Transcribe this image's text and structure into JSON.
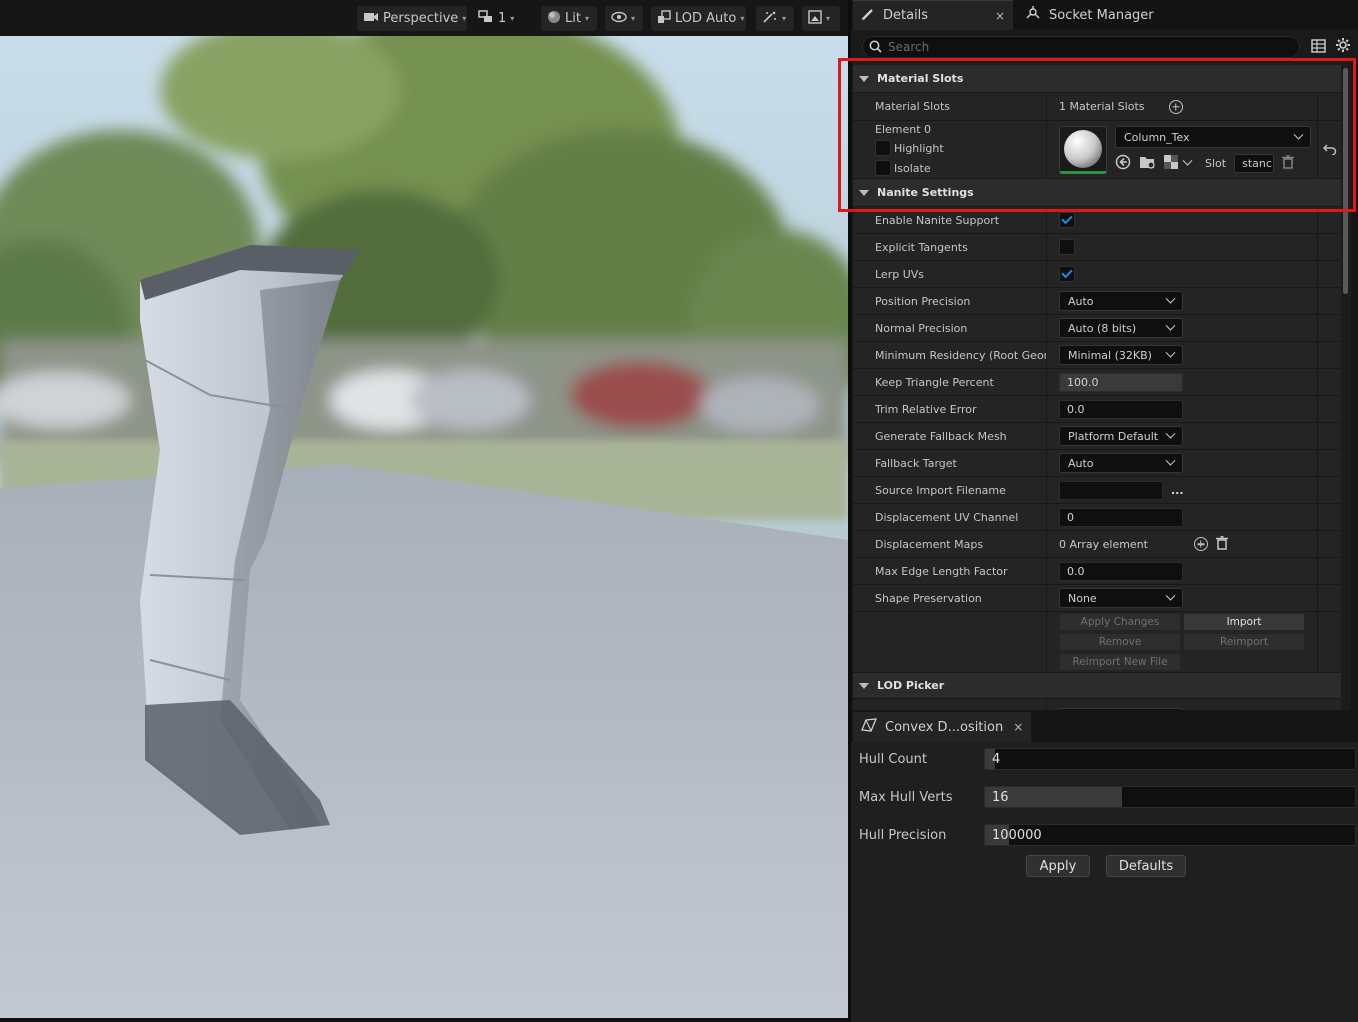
{
  "viewport": {
    "toolbar": {
      "perspective": "Perspective",
      "layers": "1",
      "lit": "Lit",
      "lod": "LOD Auto"
    }
  },
  "tabs": {
    "details": "Details",
    "details_close": "×",
    "socket_manager": "Socket Manager"
  },
  "search": {
    "placeholder": "Search"
  },
  "material_section": {
    "title": "Material Slots",
    "slots_label": "Material Slots",
    "slots_value": "1 Material Slots",
    "element_label": "Element 0",
    "highlight": "Highlight",
    "isolate": "Isolate",
    "material_name": "Column_Tex",
    "slot_label": "Slot",
    "slot_value": "stanc"
  },
  "nanite_section": {
    "title": "Nanite Settings",
    "rows": [
      {
        "label": "Enable Nanite Support",
        "type": "check",
        "checked": true
      },
      {
        "label": "Explicit Tangents",
        "type": "check",
        "checked": false
      },
      {
        "label": "Lerp UVs",
        "type": "check",
        "checked": true
      },
      {
        "label": "Position Precision",
        "type": "dropdown",
        "value": "Auto"
      },
      {
        "label": "Normal Precision",
        "type": "dropdown",
        "value": "Auto (8 bits)"
      },
      {
        "label": "Minimum Residency (Root Geome",
        "type": "dropdown",
        "value": "Minimal (32KB)"
      },
      {
        "label": "Keep Triangle Percent",
        "type": "number-gray",
        "value": "100.0"
      },
      {
        "label": "Trim Relative Error",
        "type": "number",
        "value": "0.0"
      },
      {
        "label": "Generate Fallback Mesh",
        "type": "dropdown",
        "value": "Platform Default"
      },
      {
        "label": "Fallback Target",
        "type": "dropdown",
        "value": "Auto"
      },
      {
        "label": "Source Import Filename",
        "type": "file",
        "value": "..."
      },
      {
        "label": "Displacement UV Channel",
        "type": "number",
        "value": "0"
      },
      {
        "label": "Displacement Maps",
        "type": "array",
        "value": "0 Array element"
      },
      {
        "label": "Max Edge Length Factor",
        "type": "number",
        "value": "0.0"
      },
      {
        "label": "Shape Preservation",
        "type": "dropdown",
        "value": "None"
      }
    ],
    "buttons": {
      "apply_changes": "Apply Changes",
      "import": "Import",
      "remove": "Remove",
      "reimport": "Reimport",
      "reimport_new_file": "Reimport New File"
    }
  },
  "lod_section": {
    "title": "LOD Picker"
  },
  "convex": {
    "tab_title": "Convex D...osition",
    "tab_close": "×",
    "hull_count_label": "Hull Count",
    "hull_count_value": "4",
    "max_hull_verts_label": "Max Hull Verts",
    "max_hull_verts_value": "16",
    "max_hull_verts_fill": 0.37,
    "hull_precision_label": "Hull Precision",
    "hull_precision_value": "100000",
    "apply": "Apply",
    "defaults": "Defaults"
  },
  "colors": {
    "highlight_border": "#e01818",
    "checkbox_accent": "#2a86e8",
    "panel_bg": "#242424"
  }
}
